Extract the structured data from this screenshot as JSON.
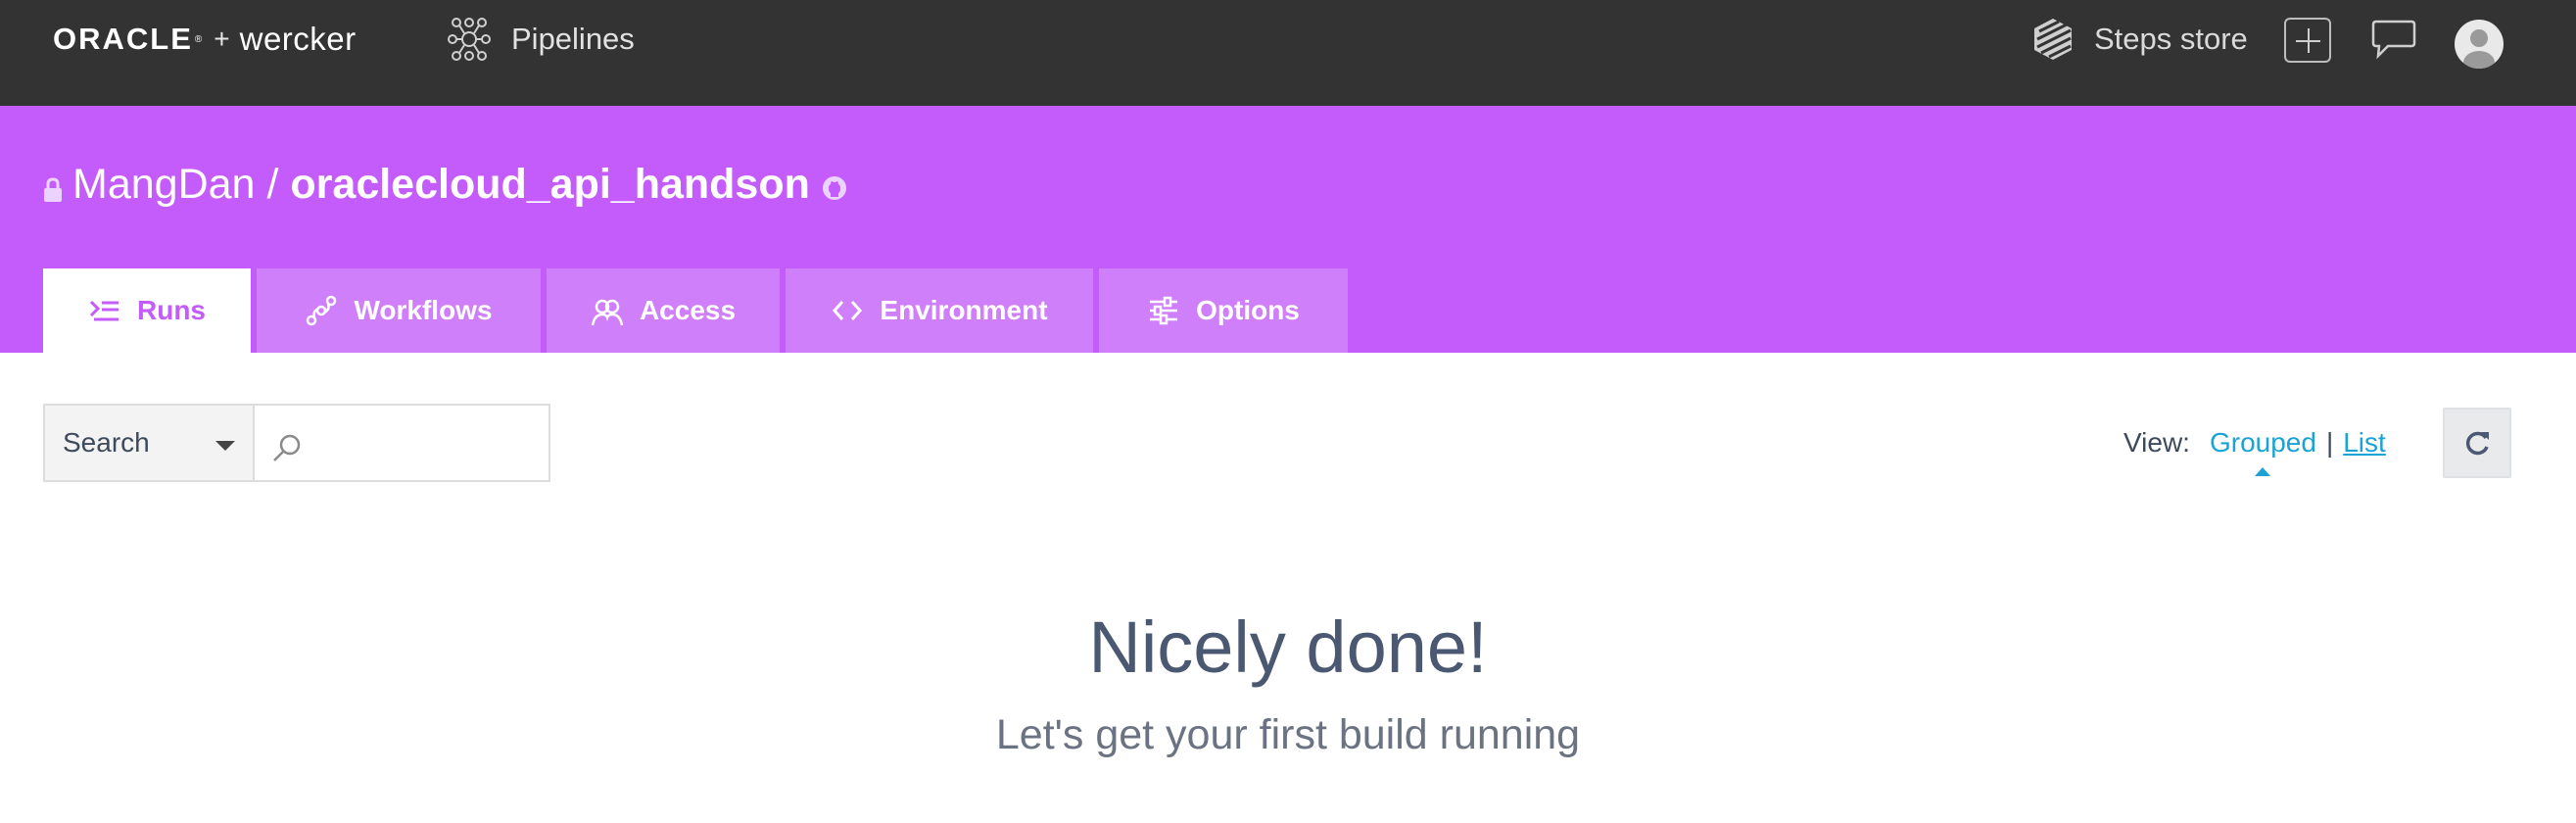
{
  "topbar": {
    "brand_oracle": "ORACLE",
    "brand_tm": "®",
    "brand_plus": "+",
    "brand_wercker": "wercker",
    "pipelines_label": "Pipelines",
    "steps_store_label": "Steps store",
    "icons": {
      "pipelines": "pipelines-icon",
      "steps_store": "steps-store-icon",
      "add": "plus-icon",
      "chat": "chat-bubble-icon",
      "avatar": "user-avatar"
    }
  },
  "header": {
    "owner": "MangDan",
    "separator": "/",
    "repo": "oraclecloud_api_handson",
    "icons": {
      "lock": "lock-icon",
      "github": "github-icon"
    }
  },
  "tabs": [
    {
      "label": "Runs",
      "icon": "runs-icon",
      "active": true
    },
    {
      "label": "Workflows",
      "icon": "workflows-icon",
      "active": false
    },
    {
      "label": "Access",
      "icon": "access-icon",
      "active": false
    },
    {
      "label": "Environment",
      "icon": "code-brackets-icon",
      "active": false
    },
    {
      "label": "Options",
      "icon": "sliders-icon",
      "active": false
    }
  ],
  "filter": {
    "search_type": "Search",
    "search_value": "",
    "search_placeholder": ""
  },
  "view": {
    "label": "View:",
    "grouped": "Grouped",
    "separator": "|",
    "list": "List",
    "selected": "Grouped"
  },
  "empty_state": {
    "title": "Nicely done!",
    "subtitle": "Let's get your first build running"
  },
  "colors": {
    "topbar": "#333333",
    "header": "#c45cfb",
    "tab_inactive": "#d07ffb",
    "link": "#1aa3d4",
    "text": "#3d4a5c"
  }
}
